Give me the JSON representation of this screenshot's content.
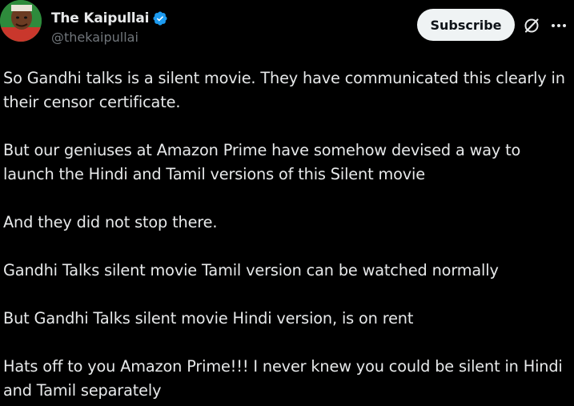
{
  "author": {
    "display_name": "The Kaipullai",
    "handle": "@thekaipullai",
    "verified": true
  },
  "actions": {
    "subscribe_label": "Subscribe",
    "grok_icon": "grok-icon",
    "more_icon": "more-icon"
  },
  "tweet": {
    "paragraphs": [
      "So Gandhi talks is a silent movie. They have communicated this clearly in their censor certificate.",
      "But our geniuses at Amazon Prime have somehow devised a way to launch the Hindi and Tamil versions of this Silent movie",
      "And they did not stop there.",
      "Gandhi Talks silent movie Tamil version can be watched normally",
      "But Gandhi Talks silent movie Hindi version, is on rent",
      "Hats off to you Amazon Prime!!! I never knew you could be silent in Hindi and Tamil separately"
    ]
  },
  "colors": {
    "background": "#000000",
    "text": "#e7e9ea",
    "secondary_text": "#71767b",
    "verified_blue": "#1d9bf0",
    "button_bg": "#eff3f4"
  }
}
